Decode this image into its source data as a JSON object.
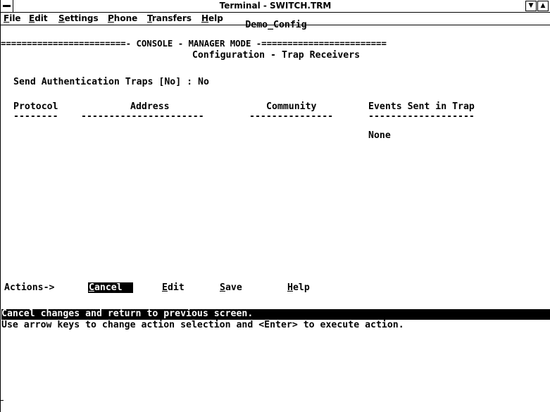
{
  "window": {
    "title": "Terminal - SWITCH.TRM",
    "min_glyph": "▼",
    "max_glyph": "▲"
  },
  "menu": [
    {
      "key": "F",
      "rest": "ile"
    },
    {
      "key": "E",
      "rest": "dit"
    },
    {
      "key": "S",
      "rest": "ettings"
    },
    {
      "key": "P",
      "rest": "hone"
    },
    {
      "key": "T",
      "rest": "ransfers"
    },
    {
      "key": "H",
      "rest": "elp"
    }
  ],
  "screen": {
    "host": "Demo_Config",
    "mode_banner": "========================- CONSOLE - MANAGER MODE -========================",
    "subtitle": "Configuration - Trap Receivers",
    "auth_traps": "Send Authentication Traps [No] : No",
    "columns": [
      "Protocol",
      "Address",
      "Community",
      "Events Sent in Trap"
    ],
    "dashes": [
      "--------",
      "----------------------",
      "---------------",
      "-------------------"
    ],
    "events_value": "None",
    "actions_label": "Actions->",
    "actions": [
      {
        "key": "C",
        "rest": "ancel",
        "selected": true
      },
      {
        "key": "E",
        "rest": "dit",
        "selected": false
      },
      {
        "key": "S",
        "rest": "ave",
        "selected": false
      },
      {
        "key": "H",
        "rest": "elp",
        "selected": false
      }
    ],
    "status_line": "Cancel changes and return to previous screen.",
    "hint_line": "Use arrow keys to change action selection and <Enter> to execute action."
  }
}
